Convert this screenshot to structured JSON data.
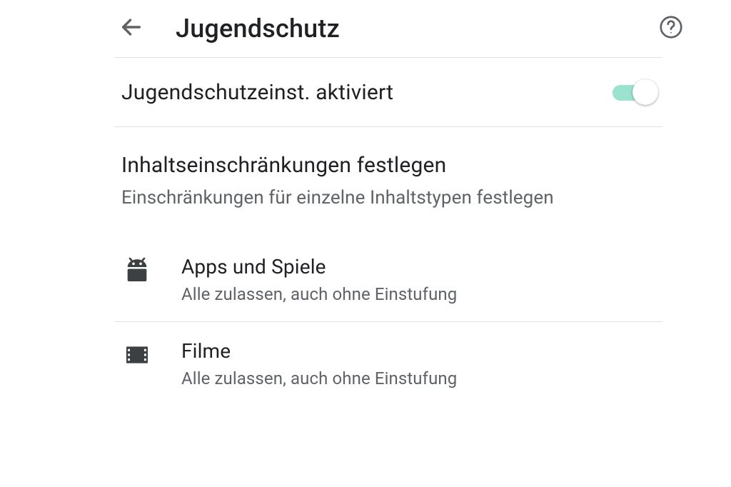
{
  "header": {
    "title": "Jugendschutz"
  },
  "toggle": {
    "label": "Jugendschutzeinst. aktiviert",
    "on": true
  },
  "section": {
    "title": "Inhaltseinschränkungen festlegen",
    "subtitle": "Einschränkungen für einzelne Inhaltstypen festlegen"
  },
  "items": [
    {
      "title": "Apps und Spiele",
      "subtitle": "Alle zulassen, auch ohne Einstufung"
    },
    {
      "title": "Filme",
      "subtitle": "Alle zulassen, auch ohne Einstufung"
    }
  ]
}
